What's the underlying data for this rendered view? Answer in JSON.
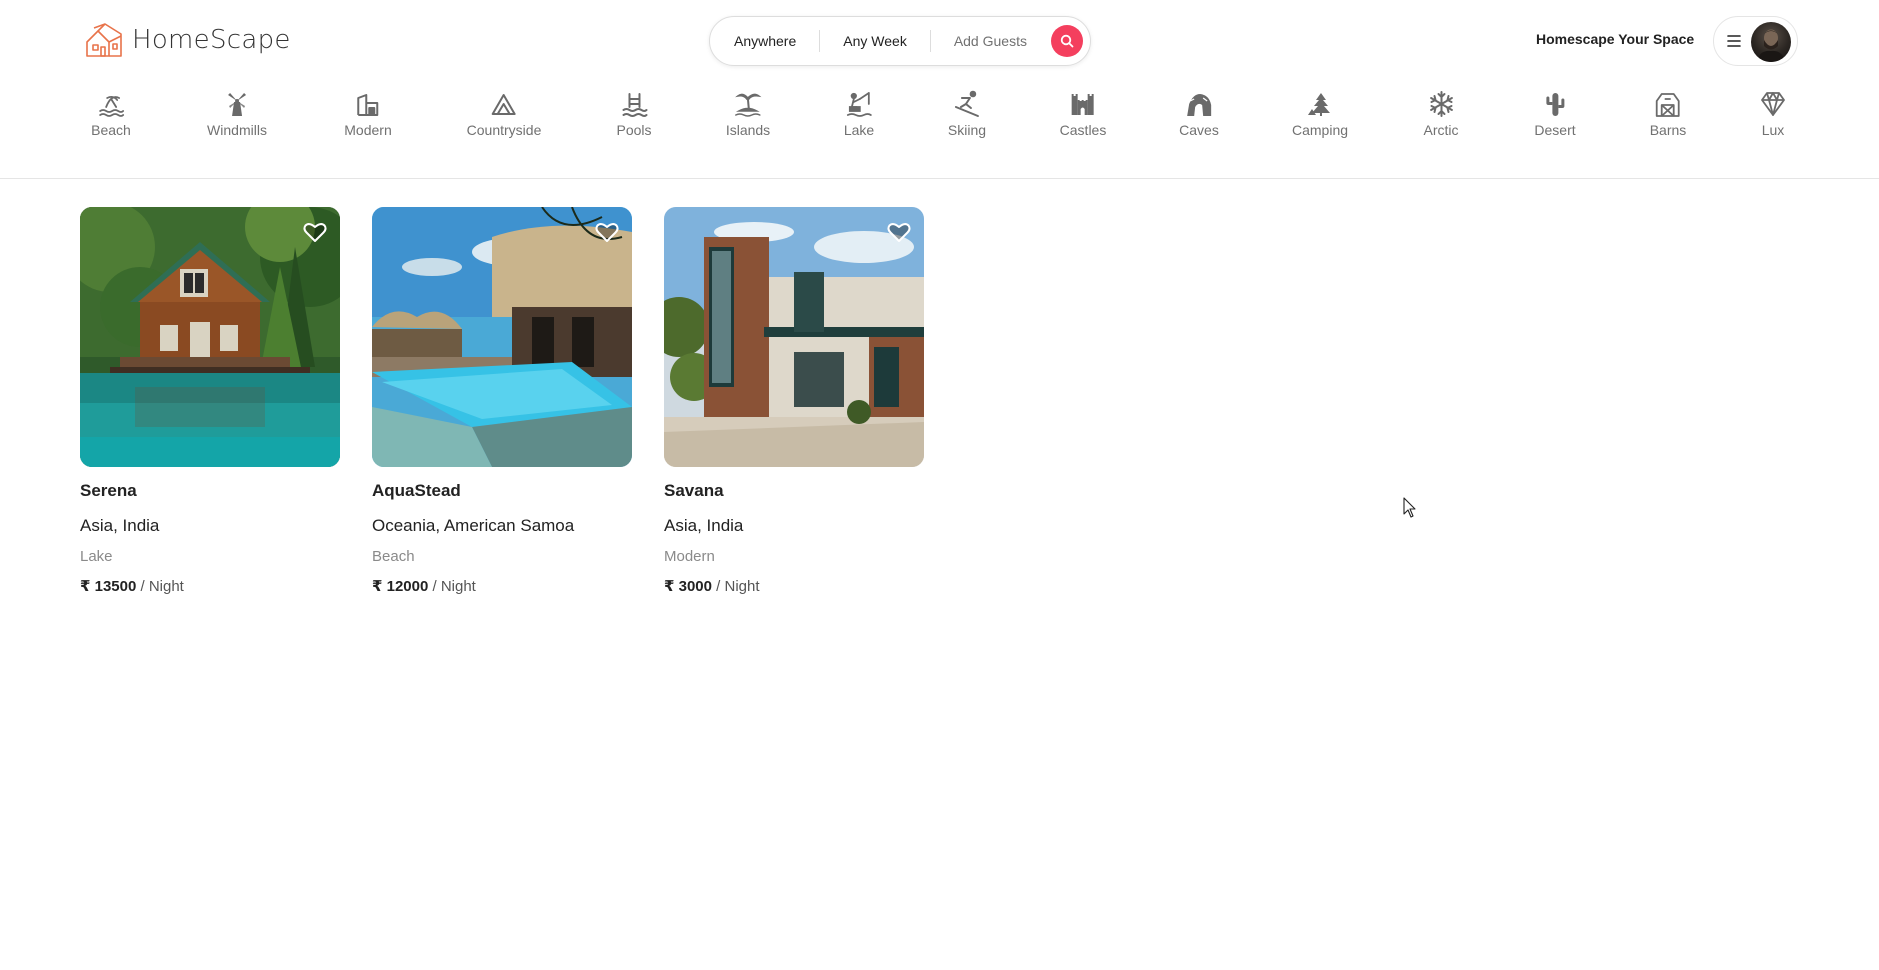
{
  "brand": {
    "name": "HomeScape",
    "accent_color": "#f43f5e",
    "logo_color": "#e8734a"
  },
  "search": {
    "where": "Anywhere",
    "when": "Any Week",
    "who": "Add Guests",
    "button_icon": "search-icon"
  },
  "header": {
    "host_link": "Homescape Your Space",
    "menu_icon": "hamburger-icon"
  },
  "categories": [
    {
      "label": "Beach",
      "icon": "beach-icon"
    },
    {
      "label": "Windmills",
      "icon": "windmill-icon"
    },
    {
      "label": "Modern",
      "icon": "modern-icon"
    },
    {
      "label": "Countryside",
      "icon": "mountain-icon"
    },
    {
      "label": "Pools",
      "icon": "pool-icon"
    },
    {
      "label": "Islands",
      "icon": "island-icon"
    },
    {
      "label": "Lake",
      "icon": "lake-icon"
    },
    {
      "label": "Skiing",
      "icon": "skiing-icon"
    },
    {
      "label": "Castles",
      "icon": "castle-icon"
    },
    {
      "label": "Caves",
      "icon": "cave-icon"
    },
    {
      "label": "Camping",
      "icon": "camping-icon"
    },
    {
      "label": "Arctic",
      "icon": "snowflake-icon"
    },
    {
      "label": "Desert",
      "icon": "cactus-icon"
    },
    {
      "label": "Barns",
      "icon": "barn-icon"
    },
    {
      "label": "Lux",
      "icon": "diamond-icon"
    }
  ],
  "listings": [
    {
      "title": "Serena",
      "location": "Asia, India",
      "category": "Lake",
      "price": "₹ 13500",
      "unit": "/ Night"
    },
    {
      "title": "AquaStead",
      "location": "Oceania, American Samoa",
      "category": "Beach",
      "price": "₹ 12000",
      "unit": "/ Night"
    },
    {
      "title": "Savana",
      "location": "Asia, India",
      "category": "Modern",
      "price": "₹ 3000",
      "unit": "/ Night"
    }
  ]
}
